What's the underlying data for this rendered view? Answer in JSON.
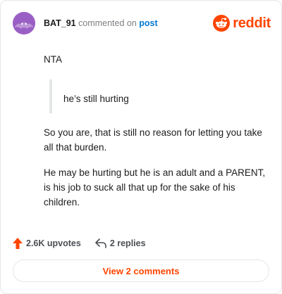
{
  "header": {
    "username": "BAT_91",
    "commented_on": "commented on",
    "post_link": "post",
    "brand": "reddit"
  },
  "comment": {
    "opening": "NTA",
    "quote": "he’s still hurting",
    "paragraph1": "So you are, that is still no reason for letting you take all that burden.",
    "paragraph2": "He may be hurting but he is an adult and a PARENT, is his job to suck all that up for the sake of his children."
  },
  "actions": {
    "upvotes": "2.6K upvotes",
    "replies": "2 replies"
  },
  "footer": {
    "view_comments": "View 2 comments"
  },
  "colors": {
    "accent": "#ff4500",
    "link": "#0079d3",
    "avatar": "#9a5fc4"
  },
  "icons": {
    "upvote": "upvote-arrow-icon",
    "reply": "reply-arrow-icon",
    "logo": "reddit-snoo-icon"
  }
}
